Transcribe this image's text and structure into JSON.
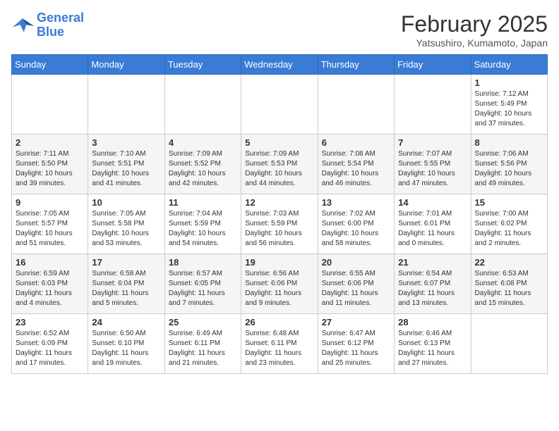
{
  "logo": {
    "line1": "General",
    "line2": "Blue"
  },
  "title": "February 2025",
  "location": "Yatsushiro, Kumamoto, Japan",
  "days_of_week": [
    "Sunday",
    "Monday",
    "Tuesday",
    "Wednesday",
    "Thursday",
    "Friday",
    "Saturday"
  ],
  "weeks": [
    [
      {
        "day": "",
        "info": ""
      },
      {
        "day": "",
        "info": ""
      },
      {
        "day": "",
        "info": ""
      },
      {
        "day": "",
        "info": ""
      },
      {
        "day": "",
        "info": ""
      },
      {
        "day": "",
        "info": ""
      },
      {
        "day": "1",
        "info": "Sunrise: 7:12 AM\nSunset: 5:49 PM\nDaylight: 10 hours and 37 minutes."
      }
    ],
    [
      {
        "day": "2",
        "info": "Sunrise: 7:11 AM\nSunset: 5:50 PM\nDaylight: 10 hours and 39 minutes."
      },
      {
        "day": "3",
        "info": "Sunrise: 7:10 AM\nSunset: 5:51 PM\nDaylight: 10 hours and 41 minutes."
      },
      {
        "day": "4",
        "info": "Sunrise: 7:09 AM\nSunset: 5:52 PM\nDaylight: 10 hours and 42 minutes."
      },
      {
        "day": "5",
        "info": "Sunrise: 7:09 AM\nSunset: 5:53 PM\nDaylight: 10 hours and 44 minutes."
      },
      {
        "day": "6",
        "info": "Sunrise: 7:08 AM\nSunset: 5:54 PM\nDaylight: 10 hours and 46 minutes."
      },
      {
        "day": "7",
        "info": "Sunrise: 7:07 AM\nSunset: 5:55 PM\nDaylight: 10 hours and 47 minutes."
      },
      {
        "day": "8",
        "info": "Sunrise: 7:06 AM\nSunset: 5:56 PM\nDaylight: 10 hours and 49 minutes."
      }
    ],
    [
      {
        "day": "9",
        "info": "Sunrise: 7:05 AM\nSunset: 5:57 PM\nDaylight: 10 hours and 51 minutes."
      },
      {
        "day": "10",
        "info": "Sunrise: 7:05 AM\nSunset: 5:58 PM\nDaylight: 10 hours and 53 minutes."
      },
      {
        "day": "11",
        "info": "Sunrise: 7:04 AM\nSunset: 5:59 PM\nDaylight: 10 hours and 54 minutes."
      },
      {
        "day": "12",
        "info": "Sunrise: 7:03 AM\nSunset: 5:59 PM\nDaylight: 10 hours and 56 minutes."
      },
      {
        "day": "13",
        "info": "Sunrise: 7:02 AM\nSunset: 6:00 PM\nDaylight: 10 hours and 58 minutes."
      },
      {
        "day": "14",
        "info": "Sunrise: 7:01 AM\nSunset: 6:01 PM\nDaylight: 11 hours and 0 minutes."
      },
      {
        "day": "15",
        "info": "Sunrise: 7:00 AM\nSunset: 6:02 PM\nDaylight: 11 hours and 2 minutes."
      }
    ],
    [
      {
        "day": "16",
        "info": "Sunrise: 6:59 AM\nSunset: 6:03 PM\nDaylight: 11 hours and 4 minutes."
      },
      {
        "day": "17",
        "info": "Sunrise: 6:58 AM\nSunset: 6:04 PM\nDaylight: 11 hours and 5 minutes."
      },
      {
        "day": "18",
        "info": "Sunrise: 6:57 AM\nSunset: 6:05 PM\nDaylight: 11 hours and 7 minutes."
      },
      {
        "day": "19",
        "info": "Sunrise: 6:56 AM\nSunset: 6:06 PM\nDaylight: 11 hours and 9 minutes."
      },
      {
        "day": "20",
        "info": "Sunrise: 6:55 AM\nSunset: 6:06 PM\nDaylight: 11 hours and 11 minutes."
      },
      {
        "day": "21",
        "info": "Sunrise: 6:54 AM\nSunset: 6:07 PM\nDaylight: 11 hours and 13 minutes."
      },
      {
        "day": "22",
        "info": "Sunrise: 6:53 AM\nSunset: 6:08 PM\nDaylight: 11 hours and 15 minutes."
      }
    ],
    [
      {
        "day": "23",
        "info": "Sunrise: 6:52 AM\nSunset: 6:09 PM\nDaylight: 11 hours and 17 minutes."
      },
      {
        "day": "24",
        "info": "Sunrise: 6:50 AM\nSunset: 6:10 PM\nDaylight: 11 hours and 19 minutes."
      },
      {
        "day": "25",
        "info": "Sunrise: 6:49 AM\nSunset: 6:11 PM\nDaylight: 11 hours and 21 minutes."
      },
      {
        "day": "26",
        "info": "Sunrise: 6:48 AM\nSunset: 6:11 PM\nDaylight: 11 hours and 23 minutes."
      },
      {
        "day": "27",
        "info": "Sunrise: 6:47 AM\nSunset: 6:12 PM\nDaylight: 11 hours and 25 minutes."
      },
      {
        "day": "28",
        "info": "Sunrise: 6:46 AM\nSunset: 6:13 PM\nDaylight: 11 hours and 27 minutes."
      },
      {
        "day": "",
        "info": ""
      }
    ]
  ]
}
